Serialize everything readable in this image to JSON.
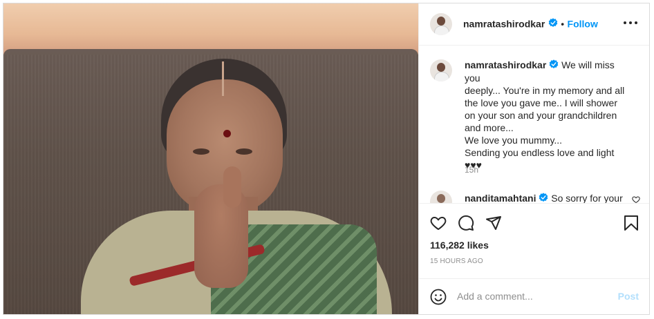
{
  "post": {
    "author": "namratashirodkar",
    "follow_separator": "•",
    "follow_label": "Follow",
    "caption_lines": [
      "We will miss you",
      "deeply... You're in my memory and all",
      "the love you gave me.. I will shower",
      "on your son and your grandchildren",
      "and more...",
      "We love you mummy...",
      "Sending you endless love and light",
      "♥♥♥"
    ],
    "caption_time": "15h",
    "second_comment": {
      "author": "nanditamahtani",
      "text": "So sorry for your"
    },
    "likes": "116,282 likes",
    "age": "15 HOURS AGO",
    "add_comment_placeholder": "Add a comment...",
    "post_label": "Post"
  },
  "icons": {
    "verified": "verified-badge-icon",
    "more": "more-options-icon",
    "like": "heart-icon",
    "comment": "comment-icon",
    "share": "share-icon",
    "save": "bookmark-icon",
    "emoji": "emoji-icon"
  },
  "colors": {
    "accent": "#0095f6",
    "post_disabled": "#b2dffc",
    "muted": "#8e8e8e"
  }
}
